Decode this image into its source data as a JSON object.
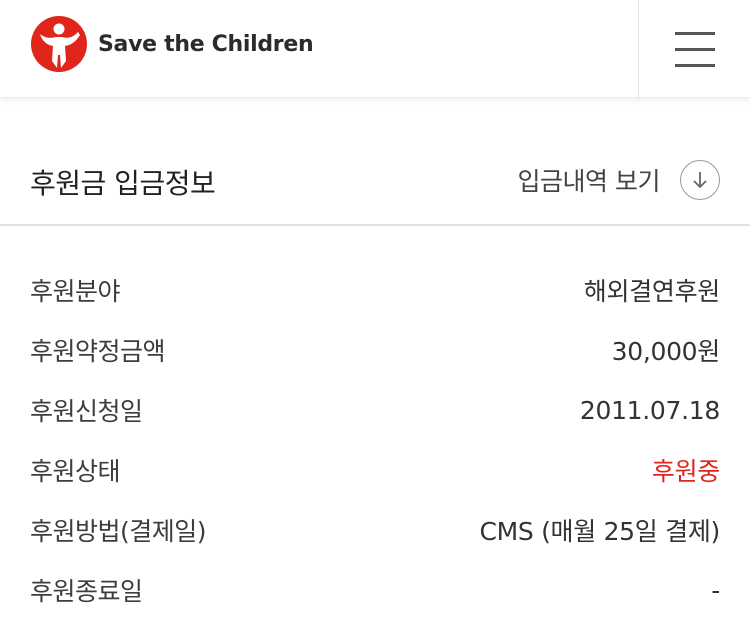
{
  "header": {
    "brand": "Save the Children",
    "logo_color": "#e0251b"
  },
  "section": {
    "title": "후원금 입금정보",
    "history_link": "입금내역 보기"
  },
  "details": [
    {
      "label": "후원분야",
      "value": "해외결연후원"
    },
    {
      "label": "후원약정금액",
      "value": "30,000원"
    },
    {
      "label": "후원신청일",
      "value": "2011.07.18"
    },
    {
      "label": "후원상태",
      "value": "후원중",
      "status_color": "#e0251b"
    },
    {
      "label": "후원방법(결제일)",
      "value": "CMS (매월 25일 결제)"
    },
    {
      "label": "후원종료일",
      "value": "-"
    }
  ]
}
